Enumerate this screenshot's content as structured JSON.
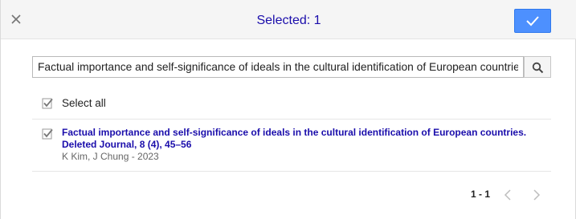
{
  "header": {
    "title": "Selected: 1",
    "close_icon": "close-icon",
    "confirm_icon": "checkmark-icon",
    "accent_color": "#4d90fe",
    "title_color": "#1a0dab"
  },
  "search": {
    "value": "Factual importance and self-significance of ideals in the cultural identification of European countries",
    "icon": "search-icon"
  },
  "select_all": {
    "label": "Select all",
    "checked": true
  },
  "results": [
    {
      "checked": true,
      "title": "Factual importance and self-significance of ideals in the cultural identification of European countries. Deleted Journal, 8 (4), 45–56",
      "authors": "K Kim, J Chung - 2023"
    }
  ],
  "pager": {
    "range": "1 - 1",
    "prev_icon": "chevron-left-icon",
    "next_icon": "chevron-right-icon"
  }
}
